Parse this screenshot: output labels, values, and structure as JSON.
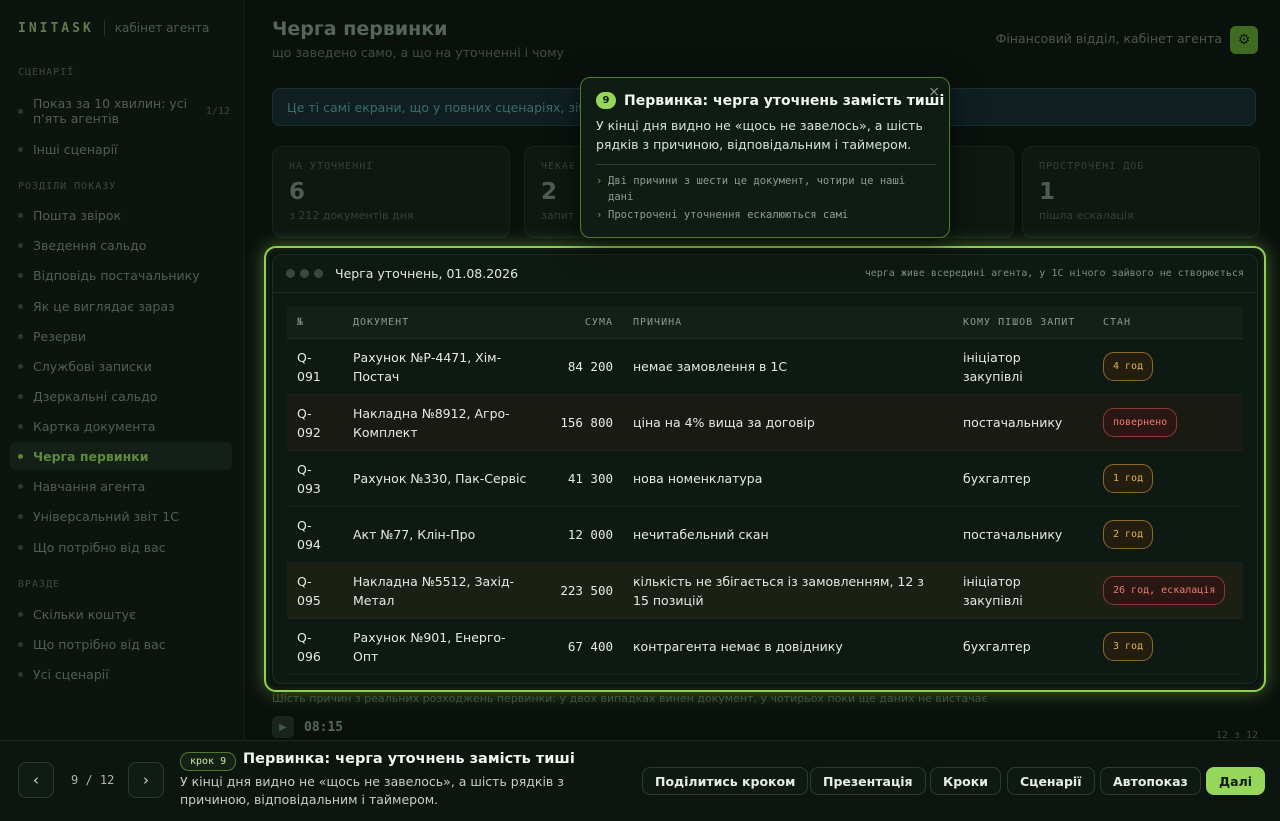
{
  "brand": {
    "name": "INITASK",
    "subtitle": "кабінет агента"
  },
  "sidebar": {
    "sections": [
      {
        "title": "СЦЕНАРІЇ",
        "items": [
          {
            "label": "Показ за 10 хвилин: усі п'ять агентів",
            "count": "1/12"
          },
          {
            "label": "Інші сценарії"
          }
        ]
      },
      {
        "title": "РОЗДІЛИ ПОКАЗУ",
        "items": [
          {
            "label": "Пошта звірок"
          },
          {
            "label": "Зведення сальдо"
          },
          {
            "label": "Відповідь постачальнику"
          },
          {
            "label": "Як це виглядає зараз"
          },
          {
            "label": "Резерви"
          },
          {
            "label": "Службові записки"
          },
          {
            "label": "Дзеркальні сальдо"
          },
          {
            "label": "Картка документа"
          },
          {
            "label": "Черга первинки",
            "active": true
          },
          {
            "label": "Навчання агента"
          },
          {
            "label": "Універсальний звіт 1С"
          },
          {
            "label": "Що потрібно від вас"
          }
        ]
      },
      {
        "title": "ВРАЗДЕ",
        "items": [
          {
            "label": "Скільки коштує"
          },
          {
            "label": "Що потрібно від вас"
          },
          {
            "label": "Усі сценарії"
          }
        ]
      }
    ]
  },
  "header": {
    "title": "Черга первинки",
    "subtitle": "що заведено само, а що на уточненні і чому",
    "breadcrumb": "Фінансовий відділ, кабінет агента",
    "gear_icon": "gear-icon"
  },
  "banner": {
    "text": "Це ті самі екрани, що у повних сценаріях, зібрані"
  },
  "stats": [
    {
      "label": "НА УТОЧНЕННІ",
      "value": "6",
      "note": "з 212 документів дня"
    },
    {
      "label": "ЧЕКАЄ",
      "value": "2",
      "note": "запит"
    },
    {
      "label": "",
      "value": "",
      "note": ""
    },
    {
      "label": "ПРОСТРОЧЕНІ ДОБ",
      "value": "1",
      "note": "пішла ескалація"
    }
  ],
  "queue": {
    "title": "Черга уточнень, 01.08.2026",
    "note": "черга живе всередині агента, у 1С нічого зайвого не створюється",
    "columns": [
      "№",
      "ДОКУМЕНТ",
      "СУМА",
      "ПРИЧИНА",
      "КОМУ ПІШОВ ЗАПИТ",
      "СТАН"
    ],
    "rows": [
      {
        "id": "Q-091",
        "doc": "Рахунок №Р-4471, Хім-Постач",
        "sum": "84 200",
        "reason": "немає замовлення в 1С",
        "to": "ініціатор закупівлі",
        "state": "4 год",
        "state_kind": "amber"
      },
      {
        "id": "Q-092",
        "doc": "Накладна №8912, Агро-Комплект",
        "sum": "156 800",
        "reason": "ціна на 4% вища за договір",
        "to": "постачальнику",
        "state": "повернено",
        "state_kind": "red"
      },
      {
        "id": "Q-093",
        "doc": "Рахунок №330, Пак-Сервіс",
        "sum": "41 300",
        "reason": "нова номенклатура",
        "to": "бухгалтер",
        "state": "1 год",
        "state_kind": "amber"
      },
      {
        "id": "Q-094",
        "doc": "Акт №77, Клін-Про",
        "sum": "12 000",
        "reason": "нечитабельний скан",
        "to": "постачальнику",
        "state": "2 год",
        "state_kind": "amber"
      },
      {
        "id": "Q-095",
        "doc": "Накладна №5512, Захід-Метал",
        "sum": "223 500",
        "reason": "кількість не збігається із замовленням, 12 з 15 позицій",
        "to": "ініціатор закупівлі",
        "state": "26 год, ескалація",
        "state_kind": "red"
      },
      {
        "id": "Q-096",
        "doc": "Рахунок №901, Енерго-Опт",
        "sum": "67 400",
        "reason": "контрагента немає в довіднику",
        "to": "бухгалтер",
        "state": "3 год",
        "state_kind": "amber"
      }
    ]
  },
  "bg_footer": {
    "text": "Шість причин з реальних розходжень первинки: у двох випадках винен документ, у чотирьох поки ще даних не вистачає",
    "time": "08:15",
    "right": "12 з 12"
  },
  "tooltip": {
    "number": "9",
    "title": "Первинка: черга уточнень замість тиші",
    "body": "У кінці дня видно не «щось не завелось», а шість рядків з причиною, відповідальним і таймером.",
    "bullets": [
      "Дві причини з шести це документ, чотири це наші дані",
      "Прострочені уточнення ескалюються самі"
    ],
    "close": "×"
  },
  "tourbar": {
    "prev": "‹",
    "next": "›",
    "counter": "9 / 12",
    "step_pill": "крок 9",
    "title": "Первинка: черга уточнень замість тиші",
    "body": "У кінці дня видно не «щось не завелось», а шість рядків з причиною, відповідальним і таймером.",
    "buttons": {
      "share": "Поділитись кроком",
      "presentation": "Презентація",
      "steps": "Кроки",
      "scenarios": "Сценарії",
      "autoplay": "Автопоказ",
      "next": "Далі"
    }
  },
  "colors": {
    "accent": "#96d65a",
    "amber": "#e3b34d",
    "red": "#ef7b6f"
  }
}
